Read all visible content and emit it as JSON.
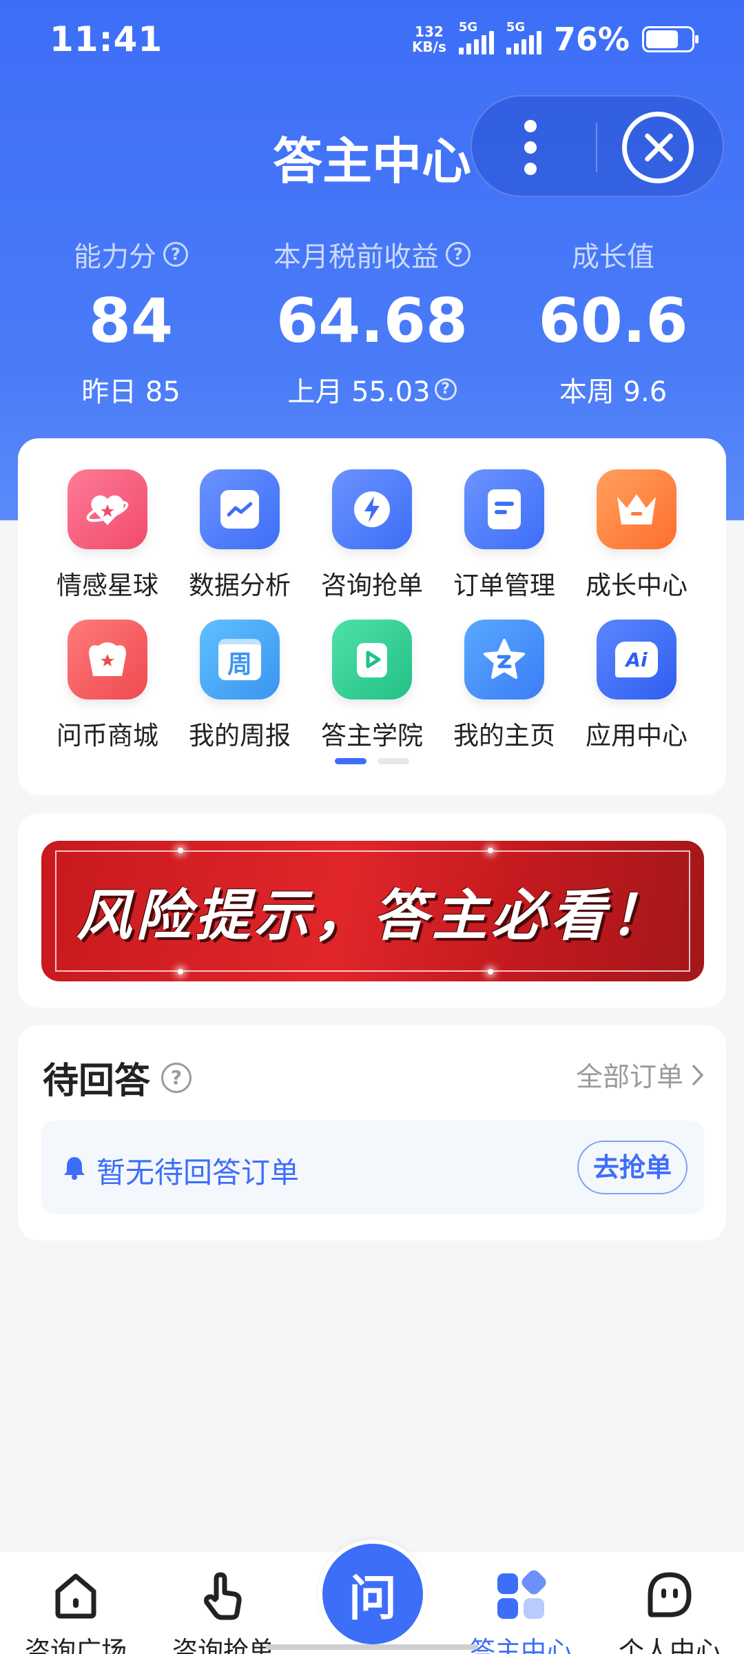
{
  "status_bar": {
    "time": "11:41",
    "net_speed_value": "132",
    "net_speed_unit": "KB/s",
    "sim1_tag": "5G",
    "sim2_tag": "5G",
    "battery": "76%"
  },
  "header": {
    "title": "答主中心"
  },
  "stats": [
    {
      "label": "能力分",
      "value": "84",
      "sub": "昨日 85"
    },
    {
      "label": "本月税前收益",
      "value": "64.68",
      "sub": "上月 55.03"
    },
    {
      "label": "成长值",
      "value": "60.6",
      "sub": "本周 9.6"
    }
  ],
  "grid": {
    "items": [
      {
        "label": "情感星球",
        "icon": "emotion-planet-icon",
        "color": "#f4587a"
      },
      {
        "label": "数据分析",
        "icon": "data-chart-icon",
        "color": "#4a78f5"
      },
      {
        "label": "咨询抢单",
        "icon": "lightning-icon",
        "color": "#4a78f5"
      },
      {
        "label": "订单管理",
        "icon": "document-icon",
        "color": "#4a78f5"
      },
      {
        "label": "成长中心",
        "icon": "crown-icon",
        "color": "#ff7a3d"
      },
      {
        "label": "问币商城",
        "icon": "shop-icon",
        "color": "#f05a5e"
      },
      {
        "label": "我的周报",
        "icon": "calendar-icon",
        "color": "#3aa5f5",
        "glyph": "周"
      },
      {
        "label": "答主学院",
        "icon": "play-book-icon",
        "color": "#2cc98e"
      },
      {
        "label": "我的主页",
        "icon": "star-icon",
        "color": "#3a8bf5"
      },
      {
        "label": "应用中心",
        "icon": "ai-chat-icon",
        "color": "#3d6ef7",
        "glyph": "Ai"
      }
    ],
    "page_count": 2,
    "current_page": 1
  },
  "banner": {
    "text": "风险提示，答主必看！",
    "color": "#d8222a"
  },
  "pending": {
    "title": "待回答",
    "all_orders": "全部订单",
    "empty_message": "暂无待回答订单",
    "grab_button": "去抢单"
  },
  "tabbar": {
    "tabs": [
      {
        "label": "咨询广场",
        "icon": "home-icon",
        "active": false
      },
      {
        "label": "咨询抢单",
        "icon": "tap-hand-icon",
        "active": false
      },
      {
        "label": "答主中心",
        "icon": "grid-apps-icon",
        "active": true
      },
      {
        "label": "个人中心",
        "icon": "smiley-face-icon",
        "active": false
      }
    ],
    "center_button": "问"
  },
  "colors": {
    "primary": "#3d6ef7",
    "background": "#f5f6f8"
  }
}
